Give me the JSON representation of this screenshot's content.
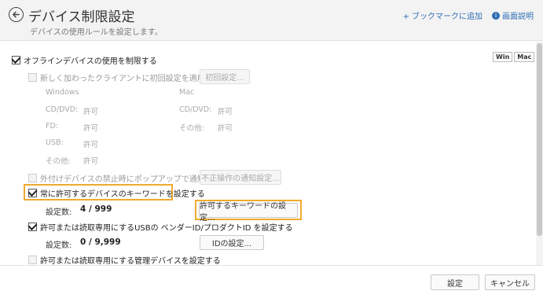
{
  "header": {
    "title": "デバイス制限設定",
    "subtitle": "デバイスの使用ルールを設定します。",
    "bookmark_link": "+ ブックマークに追加",
    "help_link": "画面説明",
    "help_icon": "i"
  },
  "os_toggle": {
    "win": "Win",
    "mac": "Mac"
  },
  "offline": {
    "label": "オフラインデバイスの使用を制限する",
    "checked": true
  },
  "initial": {
    "label": "新しく加わったクライアントに初回設定を適用する",
    "button": "初回設定...",
    "windows_heading": "Windows",
    "mac_heading": "Mac",
    "windows": [
      {
        "key": "CD/DVD:",
        "value": "許可"
      },
      {
        "key": "FD:",
        "value": "許可"
      },
      {
        "key": "USB:",
        "value": "許可"
      },
      {
        "key": "その他:",
        "value": "許可"
      }
    ],
    "mac": [
      {
        "key": "CD/DVD:",
        "value": "許可"
      },
      {
        "key": "その他:",
        "value": "許可"
      }
    ]
  },
  "popup": {
    "label": "外付けデバイスの禁止時にポップアップで通知する",
    "button": "不正操作の通知設定..."
  },
  "keyword": {
    "label": "常に許可するデバイスのキーワードを設定する",
    "count_label": "設定数:",
    "count_value": "4 / 999",
    "button": "許可するキーワードの設定..."
  },
  "usb_id": {
    "label": "許可または読取専用にするUSBの ベンダーID/プロダクトID を設定する",
    "count_label": "設定数:",
    "count_value": "0 / 9,999",
    "button": "IDの設定..."
  },
  "managed": {
    "label": "許可または読取専用にする管理デバイスを設定する"
  },
  "footer": {
    "save": "設定",
    "cancel": "キャンセル"
  },
  "colors": {
    "highlight": "#f0a92e",
    "link": "#2e6db4"
  }
}
